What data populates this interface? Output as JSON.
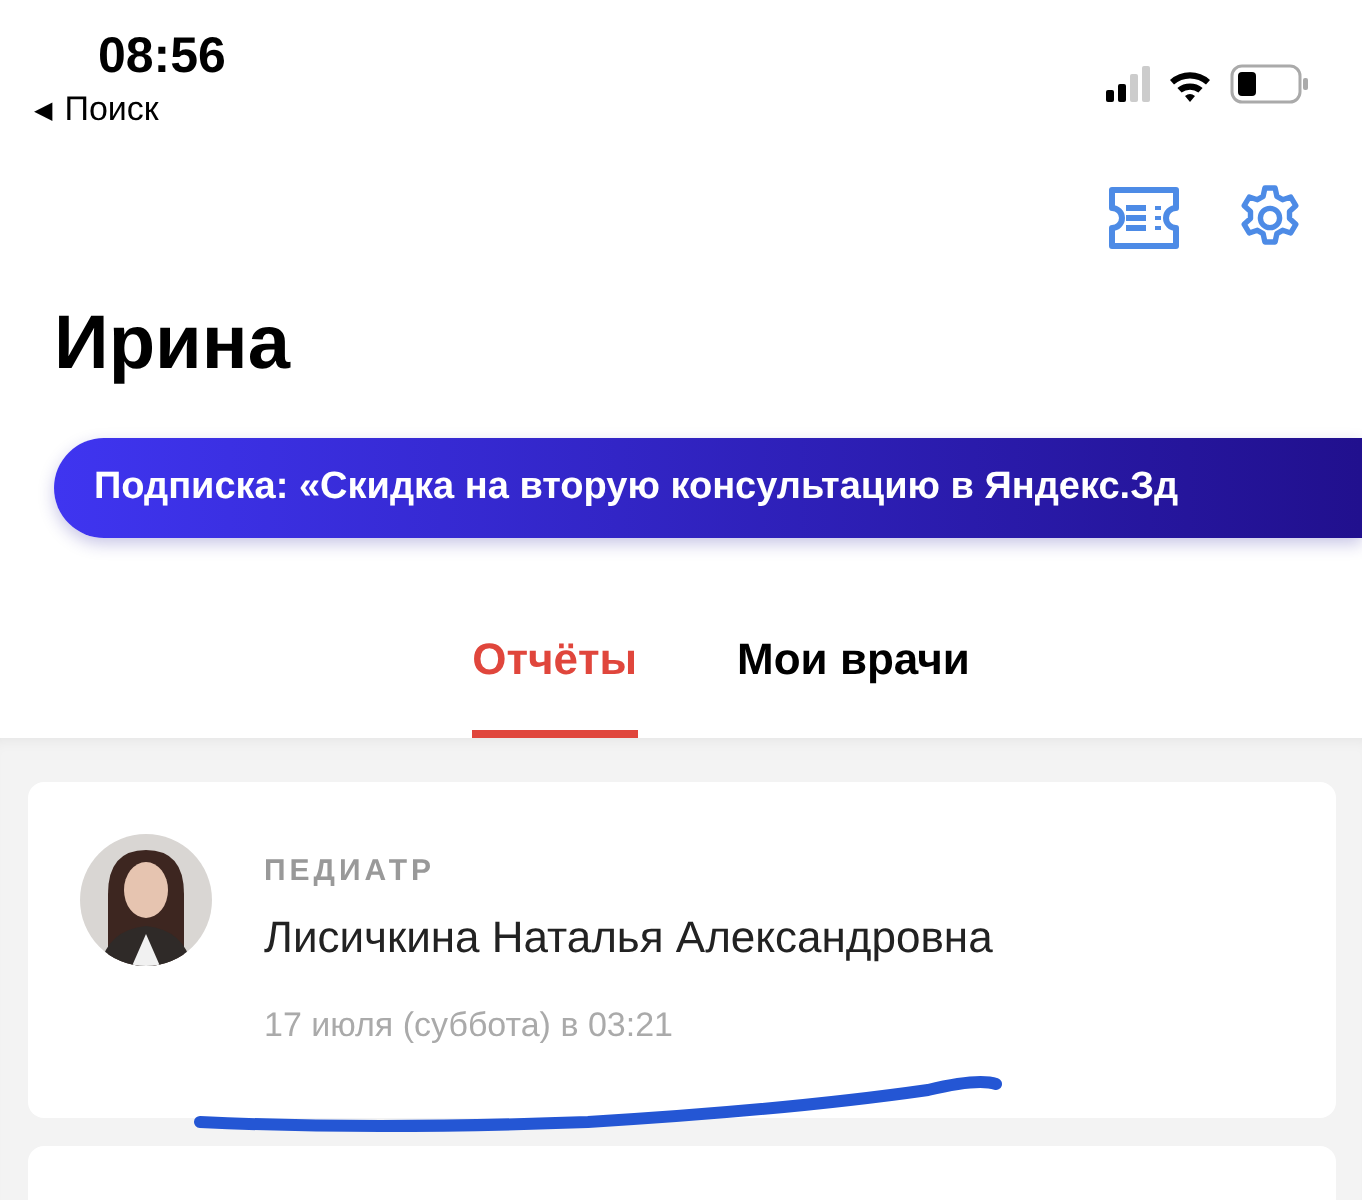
{
  "status_bar": {
    "time": "08:56",
    "back": {
      "arrow": "◀",
      "label": "Поиск"
    }
  },
  "header": {
    "title": "Ирина"
  },
  "banner": {
    "text": "Подписка: «Скидка на вторую консультацию в Яндекс.Зд"
  },
  "tabs": [
    {
      "label": "Отчёты",
      "selected": true
    },
    {
      "label": "Мои врачи",
      "selected": false
    }
  ],
  "reports": [
    {
      "specialty": "ПЕДИАТР",
      "doctor": "Лисичкина Наталья Александровна",
      "date": "17 июля (суббота) в 03:21",
      "underlined": true
    }
  ]
}
